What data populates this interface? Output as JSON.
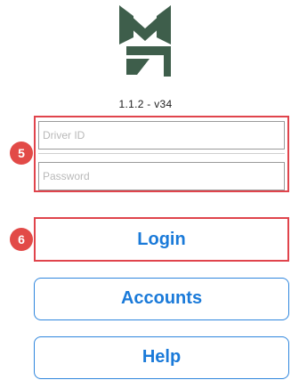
{
  "app": {
    "logo": "app-logo",
    "version": "1.1.2 - v34",
    "brand_color": "#3e5e4b"
  },
  "login_form": {
    "driver_id_placeholder": "Driver ID",
    "driver_id_value": "",
    "password_placeholder": "Password",
    "password_value": ""
  },
  "annotations": {
    "badge_form": "5",
    "badge_login": "6",
    "highlight_color": "#e0444c"
  },
  "buttons": {
    "login": "Login",
    "accounts": "Accounts",
    "help": "Help",
    "accent_color": "#1a7ad9"
  }
}
